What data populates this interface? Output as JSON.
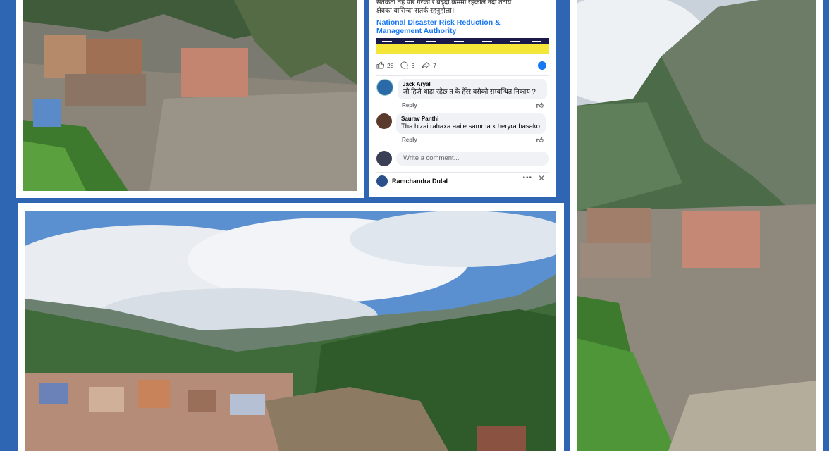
{
  "post": {
    "text_line1": "सतर्कता तह पार गरेको र बढ्दो क्रममा रहेकोले नदी तटीय",
    "text_line2": "क्षेत्रका बासिन्दा सतर्क रहनुहोला।",
    "org_line1": "National Disaster Risk Reduction &",
    "org_line2": "Management Authority",
    "likes": "28",
    "comments": "6",
    "shares": "7"
  },
  "comments": [
    {
      "name": "Jack Aryal",
      "text": "जो हिजै थाहा रहेछ त के हेरेर बसेको सम्बन्धित निकाय ?",
      "reply": "Reply"
    },
    {
      "name": "Saurav Panthi",
      "text": "Tha hizai rahaxa aaile samma k heryra basako",
      "reply": "Reply"
    }
  ],
  "composer": {
    "placeholder": "Write a comment..."
  },
  "next_comment": {
    "name": "Ramchandra Dulal"
  },
  "icons": [
    "like-icon",
    "comment-icon",
    "share-icon",
    "thumbs-up-icon",
    "more-icon",
    "close-icon"
  ],
  "colors": {
    "frame": "#2f66b4",
    "link": "#1877f2"
  }
}
